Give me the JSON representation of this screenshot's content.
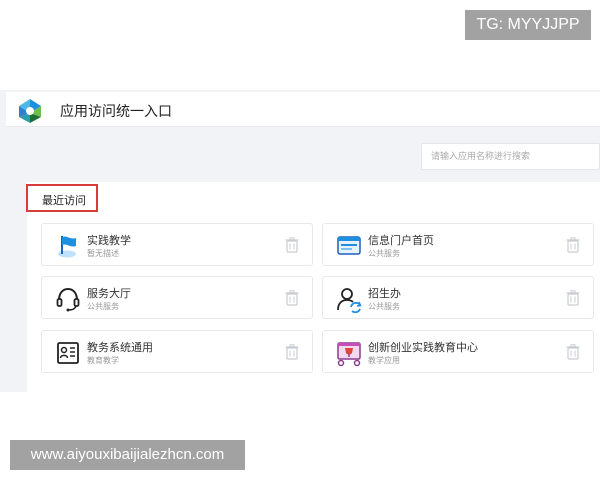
{
  "watermark": {
    "tg_label": "TG: MYYJJPP",
    "site_url": "www.aiyouxibaijialezhcn.com"
  },
  "header": {
    "title": "应用访问统一入口",
    "logo_icon": "app-portal-logo-icon"
  },
  "search": {
    "placeholder": "请输入应用名称进行搜索"
  },
  "recent": {
    "section_title": "最近访问",
    "items": [
      {
        "title": "实践教学",
        "subtitle": "暂无描述",
        "icon": "flag-icon"
      },
      {
        "title": "信息门户首页",
        "subtitle": "公共服务",
        "icon": "browser-window-icon"
      },
      {
        "title": "服务大厅",
        "subtitle": "公共服务",
        "icon": "headset-icon"
      },
      {
        "title": "招生办",
        "subtitle": "公共服务",
        "icon": "users-refresh-icon"
      },
      {
        "title": "教务系统通用",
        "subtitle": "教育教学",
        "icon": "id-card-icon"
      },
      {
        "title": "创新创业实践教育中心",
        "subtitle": "教学应用",
        "icon": "trophy-screen-icon"
      }
    ]
  },
  "colors": {
    "highlight_border": "#d93a3a",
    "background": "#f1f3f6",
    "accent_blue": "#1d8fe0"
  }
}
